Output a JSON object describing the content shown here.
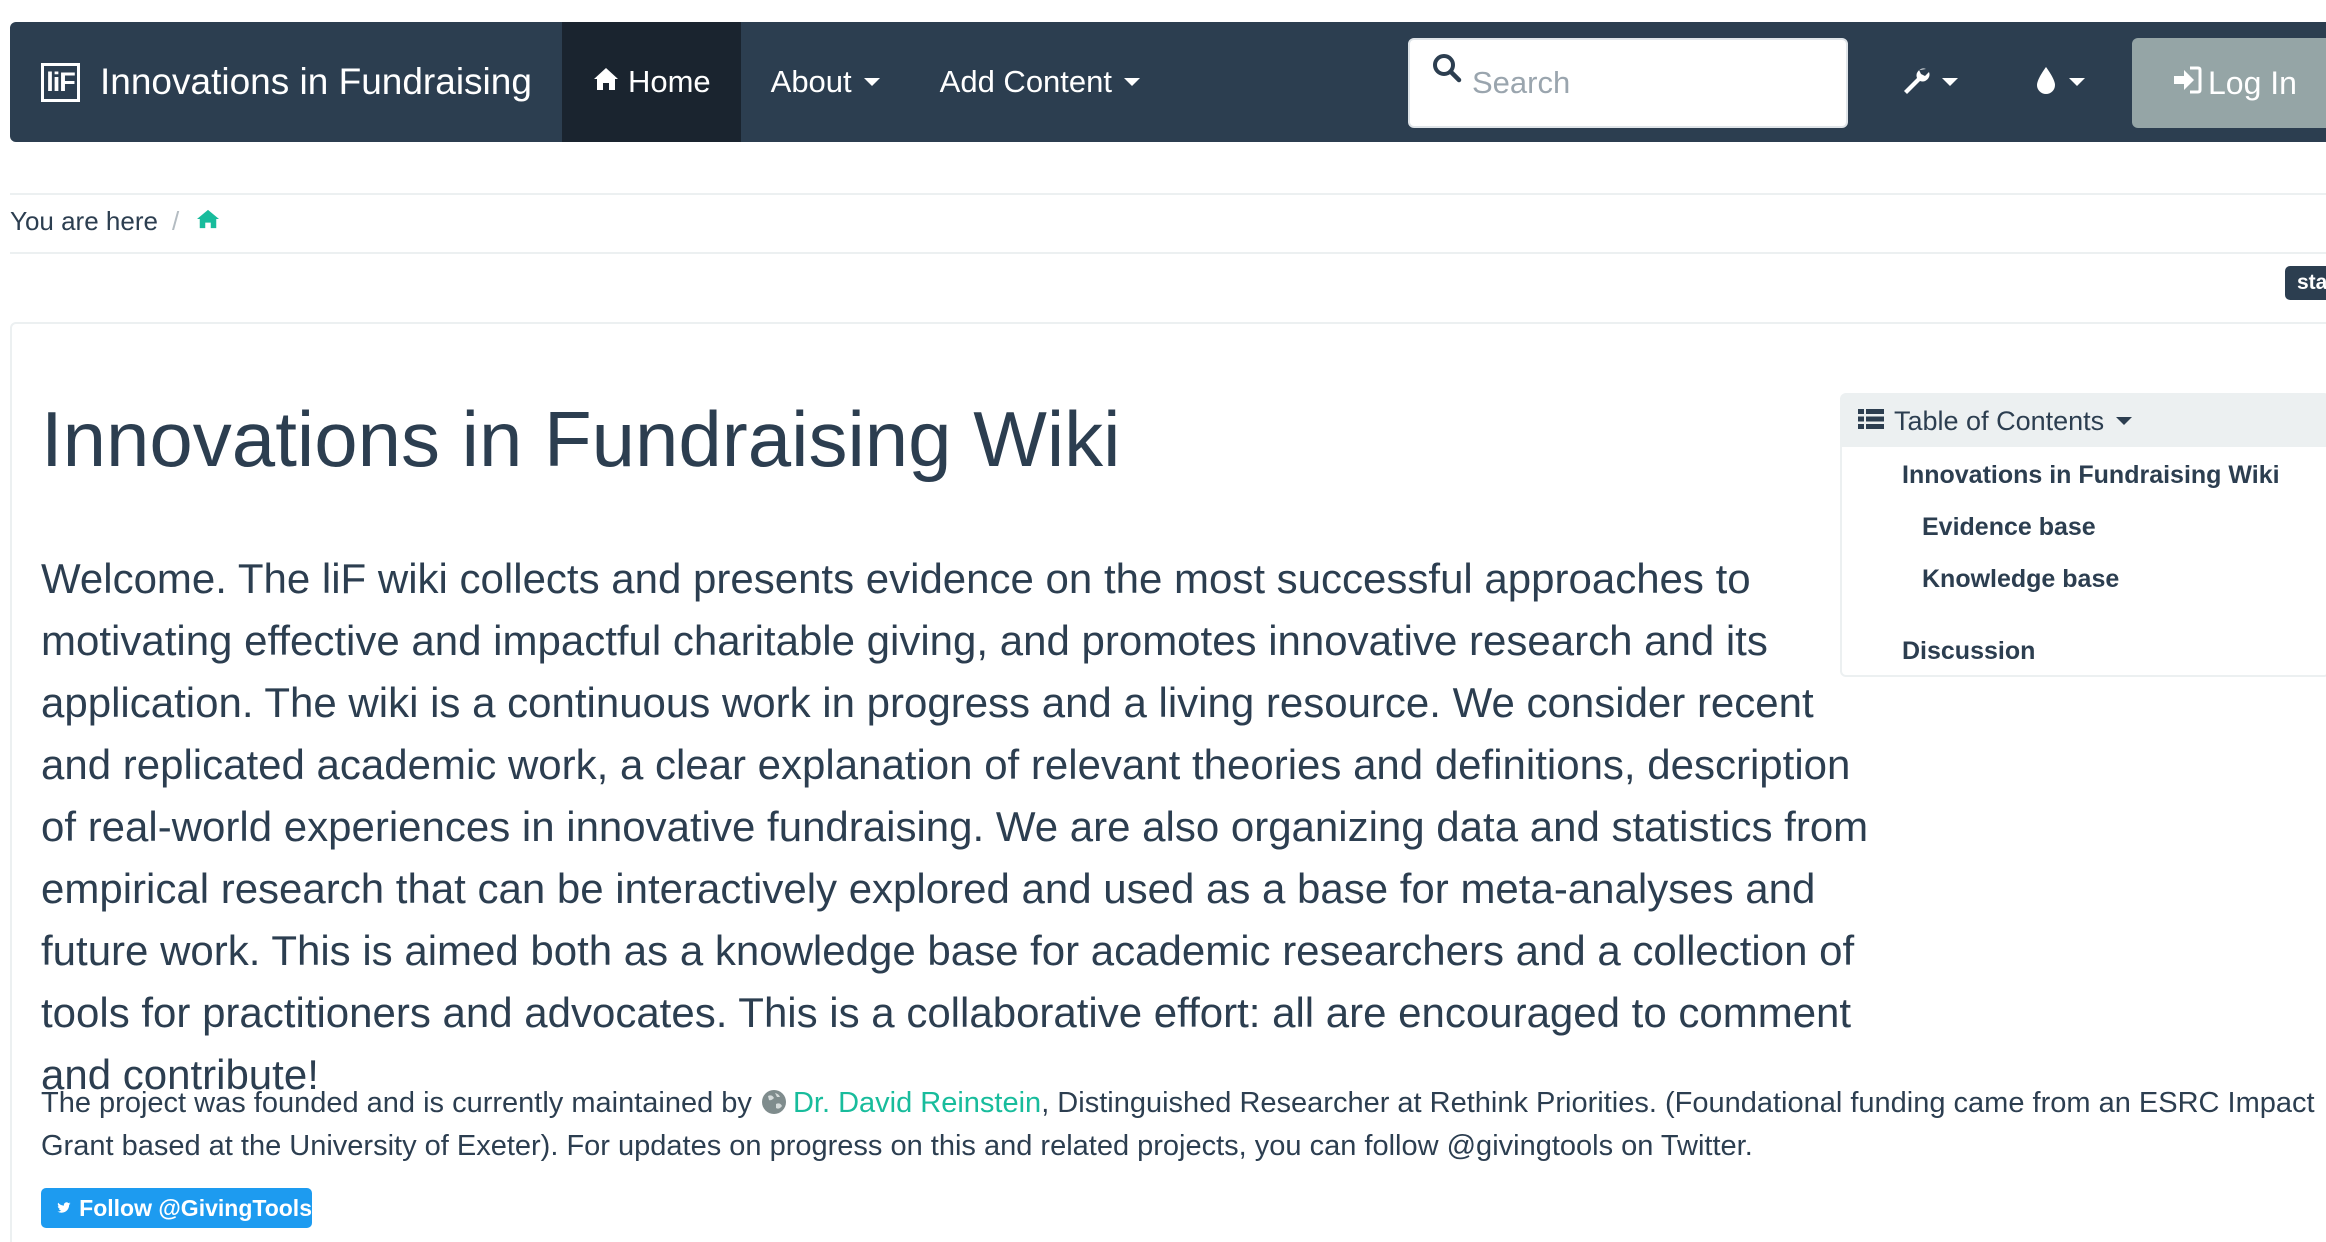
{
  "navbar": {
    "brand_logo": "liF",
    "brand_title": "Innovations in Fundraising",
    "home_label": "Home",
    "about_label": "About",
    "add_content_label": "Add Content",
    "search_placeholder": "Search",
    "login_label": "Log In"
  },
  "breadcrumb": {
    "label": "You are here",
    "separator": "/"
  },
  "status_tag": "sta",
  "main": {
    "title": "Innovations in Fundraising Wiki",
    "lead": "Welcome. The liF wiki collects and presents evidence on the most successful approaches to motivating effective and impactful charitable giving, and promotes innovative research and its application. The wiki is a continuous work in progress and a living resource. We consider recent and replicated academic work, a clear explanation of relevant theories and definitions, description of real-world experiences in innovative fundraising. We are also organizing data and statistics from empirical research that can be interactively explored and used as a base for meta-analyses and future work. This is aimed both as a knowledge base for academic researchers and a collection of tools for practitioners and advocates. This is a collaborative effort: all are encouraged to comment and contribute!",
    "body_prefix": "The project was founded and is currently maintained by ",
    "body_link": "Dr. David Reinstein",
    "body_suffix": ", Distinguished Researcher at Rethink Priorities. (Foundational funding came from an ESRC Impact Grant based at the University of Exeter). For updates on progress on this and related projects, you can follow @givingtools on Twitter.",
    "twitter_button": "Follow @GivingTools"
  },
  "toc": {
    "title": "Table of Contents",
    "items": [
      {
        "label": "Innovations in Fundraising Wiki",
        "level": 1
      },
      {
        "label": "Evidence base",
        "level": 2
      },
      {
        "label": "Knowledge base",
        "level": 2
      },
      {
        "label": "Discussion",
        "level": 1
      }
    ]
  },
  "colors": {
    "navbar": "#2c3e50",
    "navbar_active": "#1a242f",
    "accent_link": "#18bc9c",
    "login_button": "#95a5a6",
    "twitter": "#1d9bf0"
  }
}
